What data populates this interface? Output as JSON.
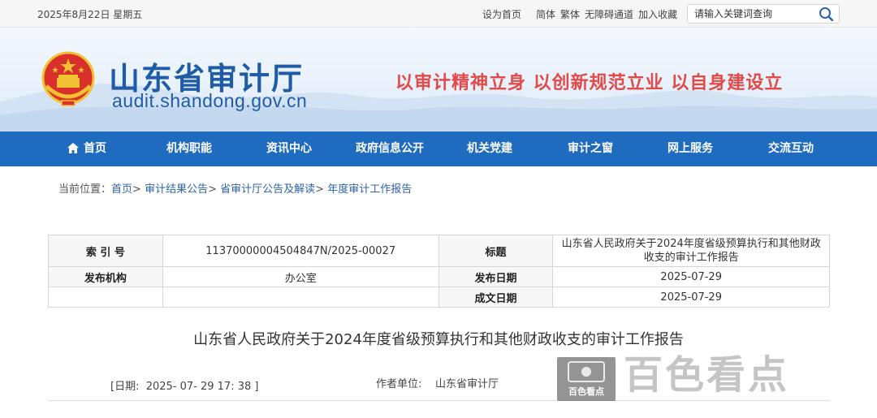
{
  "topbar": {
    "date": "2025年8月22日 星期五",
    "set_home": "设为首页",
    "simplified": "简体",
    "traditional": "繁体",
    "accessibility": "无障碍通道",
    "favorite": "加入收藏",
    "search_placeholder": "请输入关键词查询",
    "search_icon": "search-icon"
  },
  "header": {
    "site_name": "山东省审计厅",
    "domain": "audit.shandong.gov.cn",
    "slogan": "以审计精神立身 以创新规范立业 以自身建设立",
    "emblem_icon": "national-emblem-icon"
  },
  "nav": {
    "items": [
      {
        "label": "首页",
        "icon": "home-icon"
      },
      {
        "label": "机构职能"
      },
      {
        "label": "资讯中心"
      },
      {
        "label": "政府信息公开"
      },
      {
        "label": "机关党建"
      },
      {
        "label": "审计之窗"
      },
      {
        "label": "网上服务"
      },
      {
        "label": "交流互动"
      }
    ]
  },
  "breadcrumb": {
    "prefix": "当前位置：",
    "items": [
      "首页",
      "审计结果公告",
      "省审计厅公告及解读",
      "年度审计工作报告"
    ],
    "separator": ">"
  },
  "meta": {
    "index_label": "索 引 号",
    "index_value": "11370000004504847N/2025-00027",
    "title_label": "标题",
    "title_value": "山东省人民政府关于2024年度省级预算执行和其他财政收支的审计工作报告",
    "publisher_label": "发布机构",
    "publisher_value": "办公室",
    "publish_date_label": "发布日期",
    "publish_date_value": "2025-07-29",
    "created_date_label": "成文日期",
    "created_date_value": "2025-07-29"
  },
  "document": {
    "title": "山东省人民政府关于2024年度省级预算执行和其他财政收支的审计工作报告",
    "date_line": "[日期:  2025- 07- 29 17: 38 ]",
    "author_label": "作者单位:",
    "author_value": "山东省审计厅"
  },
  "watermark": {
    "small_text": "百色看点",
    "big_text": "百色看点"
  },
  "colors": {
    "nav_bg": "#1e6bbf",
    "brand_blue": "#1f5ca8",
    "slogan_red": "#e24a4a",
    "link_blue": "#2d63a8"
  }
}
